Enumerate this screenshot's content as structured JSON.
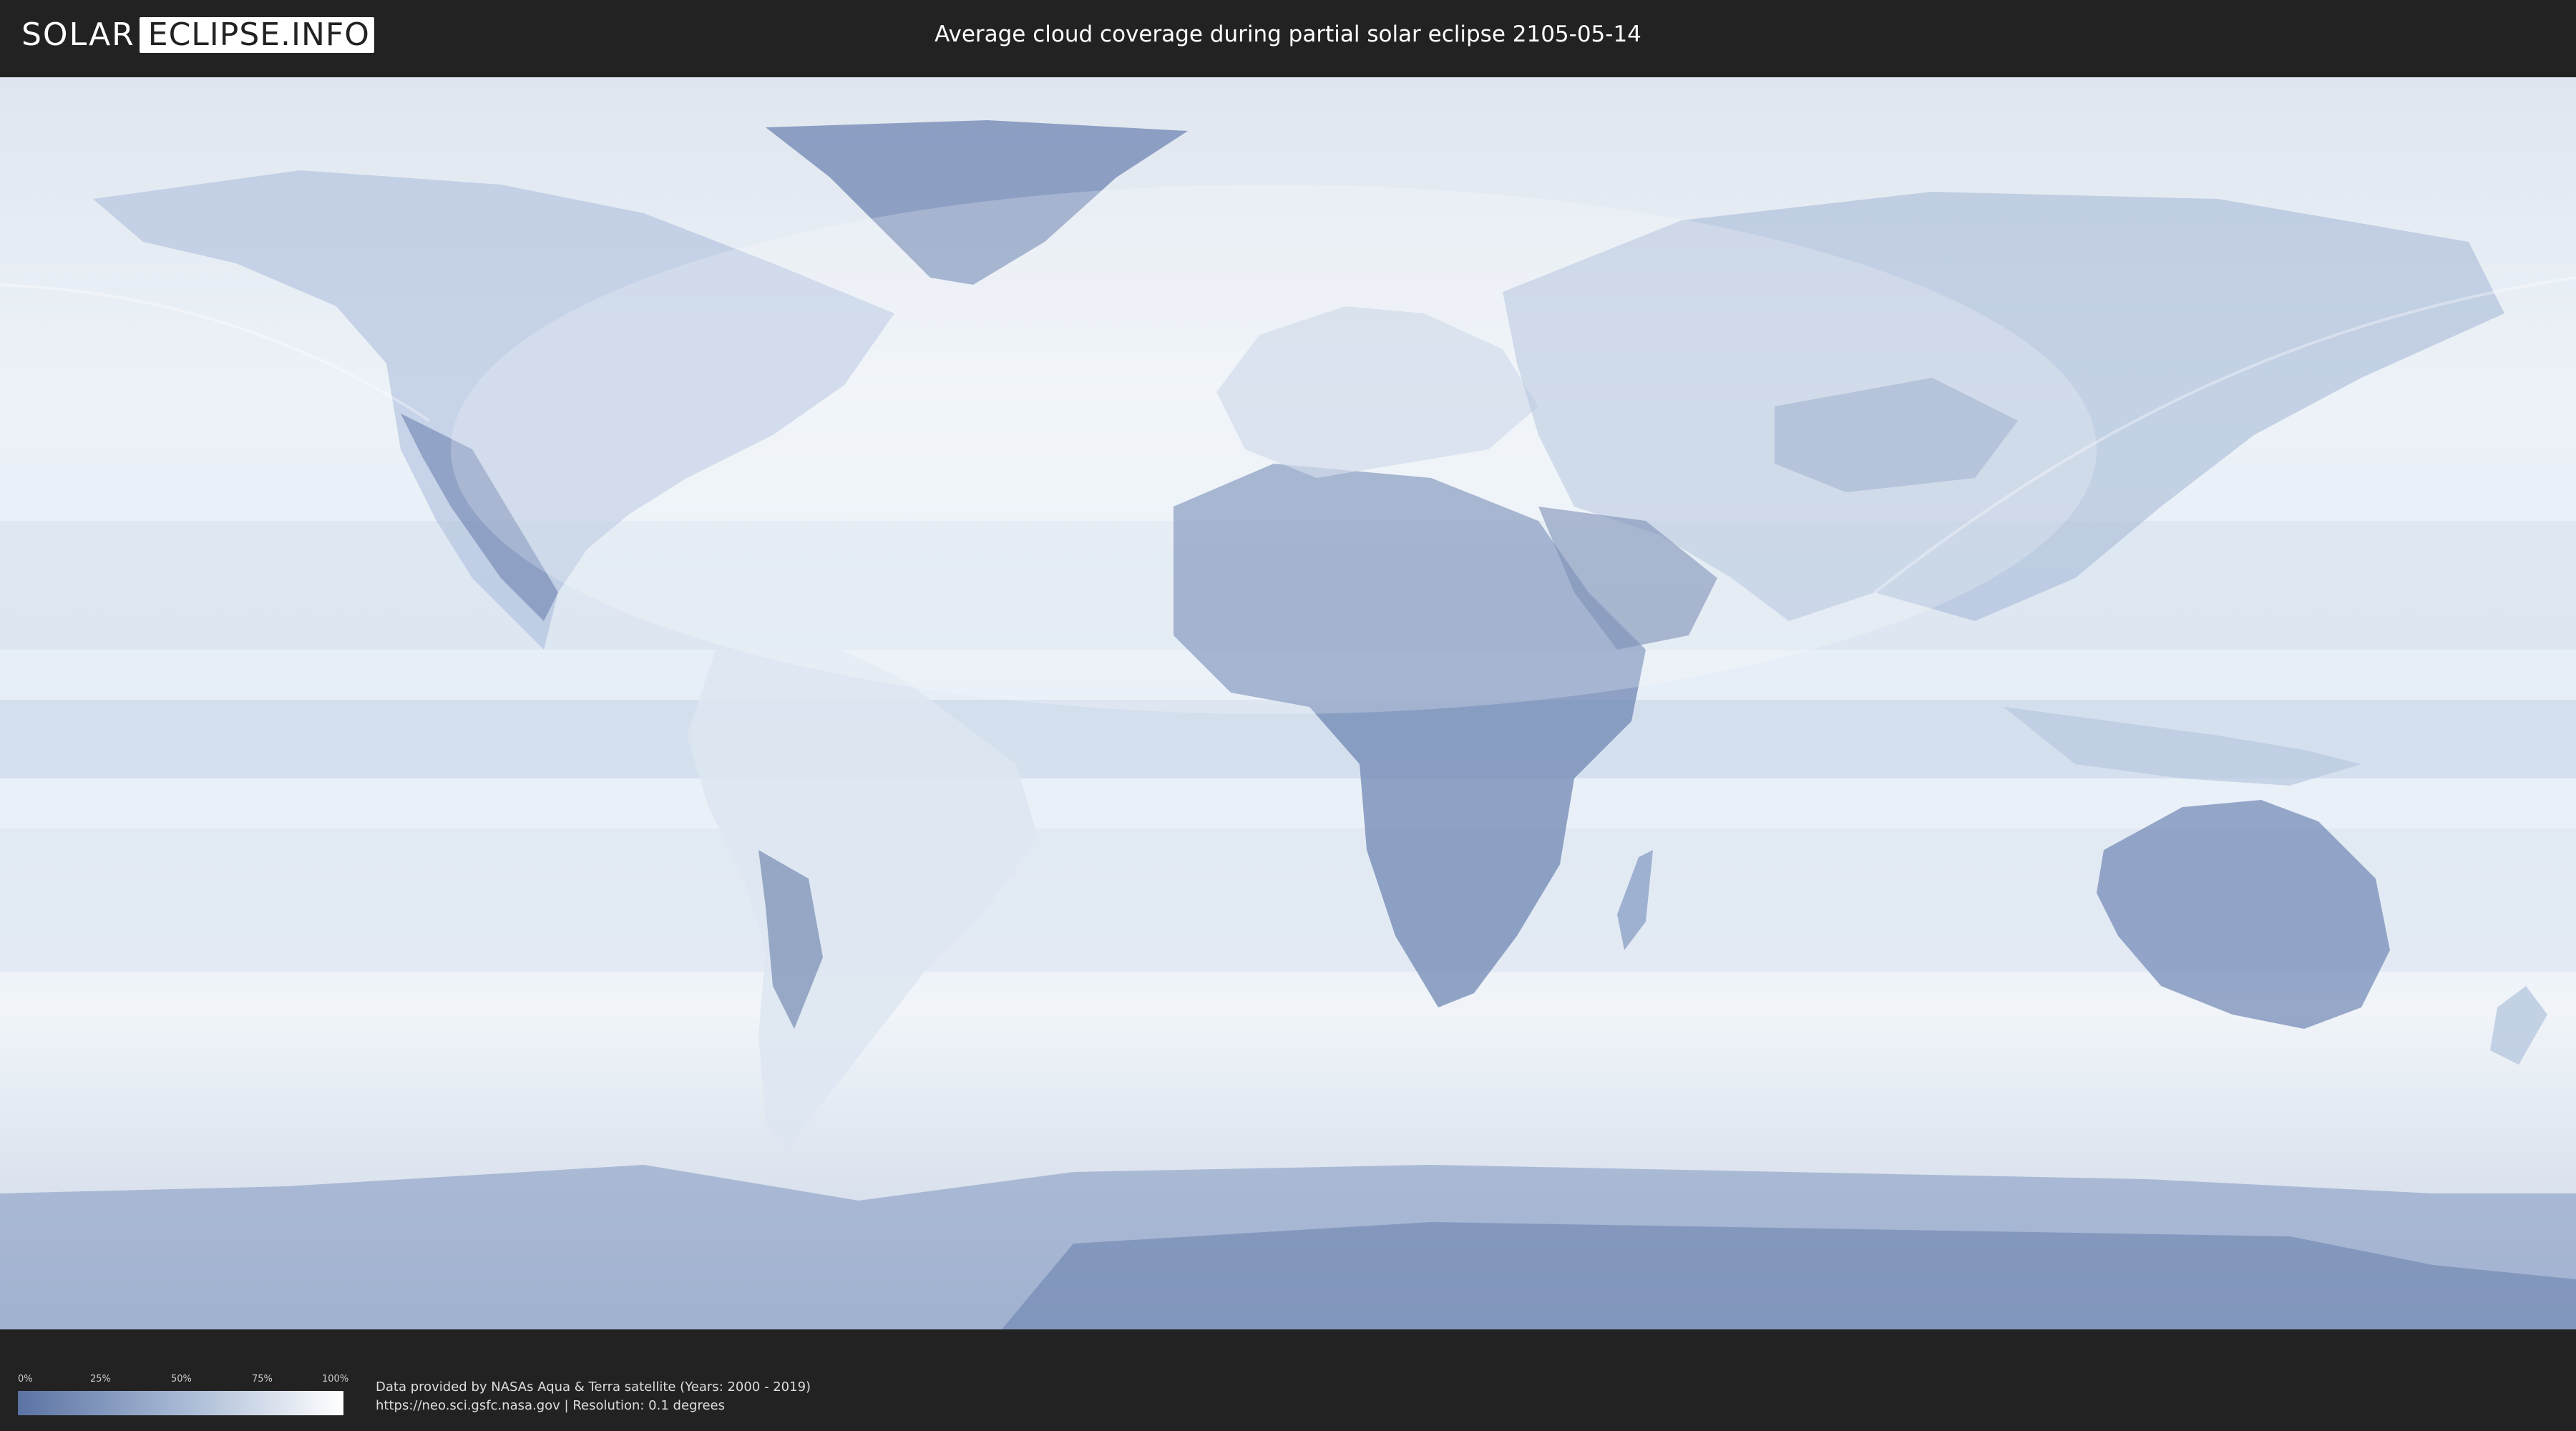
{
  "header": {
    "logo_left": "SOLAR",
    "logo_right": "ECLIPSE.INFO",
    "title": "Average cloud coverage during partial solar eclipse 2105-05-14"
  },
  "map": {
    "projection": "equirectangular",
    "ocean_color": "#e9f0f8",
    "cloud_color": "#dfe8f3",
    "clear_land_color": "#5b73a3",
    "eclipse_overlay_color": "#ffffff"
  },
  "legend": {
    "ticks": [
      "0%",
      "25%",
      "50%",
      "75%",
      "100%"
    ],
    "gradient": [
      "#5b73a3",
      "#a6b8d4",
      "#ffffff"
    ]
  },
  "credits": {
    "line1": "Data provided by NASAs Aqua & Terra satellite (Years: 2000 - 2019)",
    "line2": "https://neo.sci.gsfc.nasa.gov | Resolution: 0.1 degrees"
  }
}
